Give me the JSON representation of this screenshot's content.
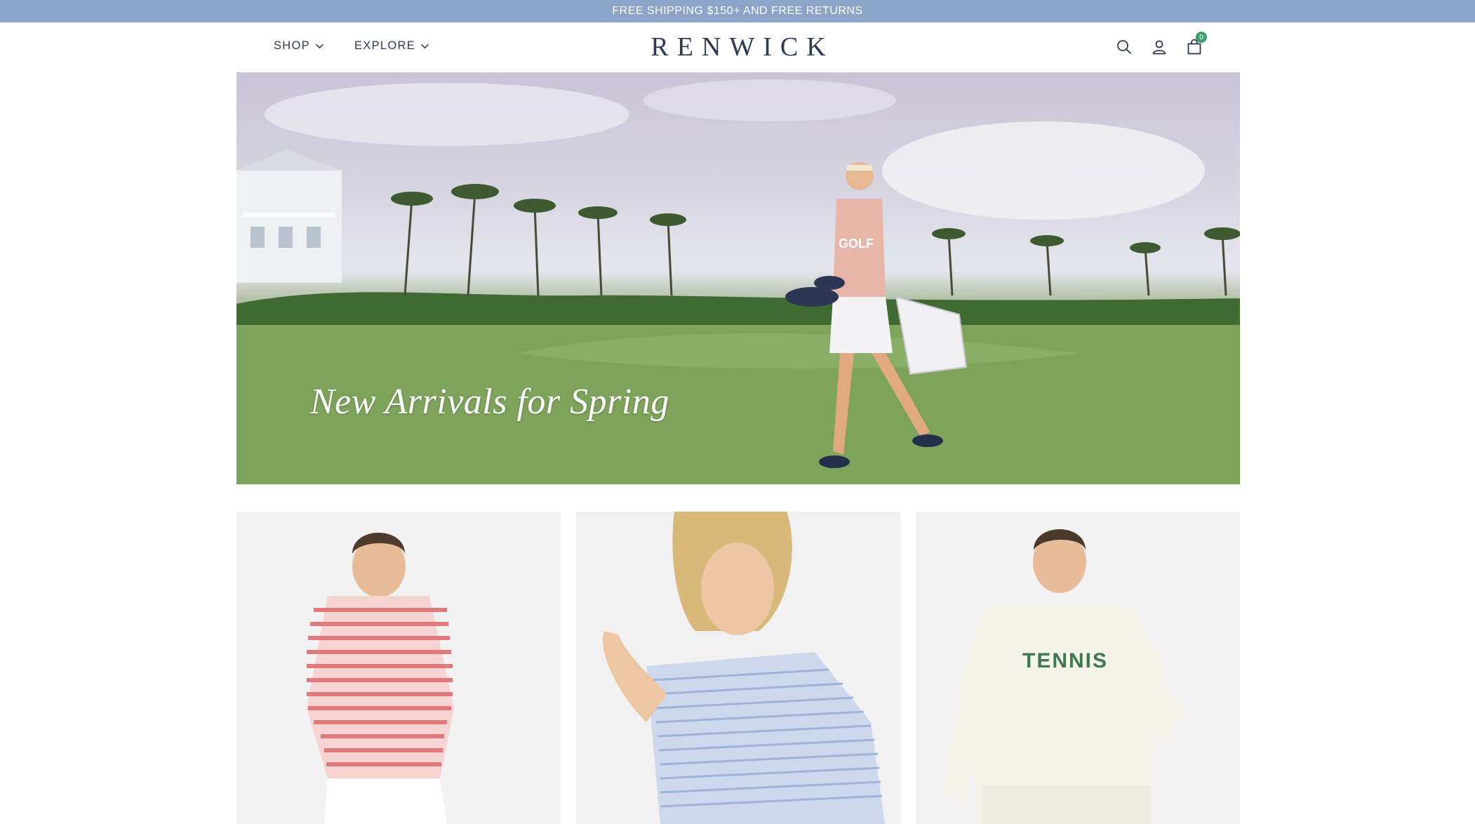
{
  "announcement": {
    "text": "FREE SHIPPING $150+ AND FREE RETURNS"
  },
  "nav": {
    "shop_label": "SHOP",
    "explore_label": "EXPLORE"
  },
  "brand": {
    "logo_text": "RENWICK"
  },
  "header_icons": {
    "search": "search-icon",
    "account": "user-icon",
    "cart": "shopping-bag-icon",
    "cart_count": "0"
  },
  "hero": {
    "title": "New Arrivals for Spring",
    "image": "golfer-on-course-photo"
  },
  "product_cards": [
    {
      "image": "woman-in-red-striped-polo-photo"
    },
    {
      "image": "woman-in-blue-striped-polo-photo"
    },
    {
      "image": "woman-in-tennis-sweater-photo",
      "print_text": "TENNIS"
    }
  ],
  "colors": {
    "announcement_bg": "#8aa5c8",
    "brand_navy": "#2d3a55",
    "cart_badge": "#3f9f6b",
    "tennis_green": "#3d7a4e"
  }
}
